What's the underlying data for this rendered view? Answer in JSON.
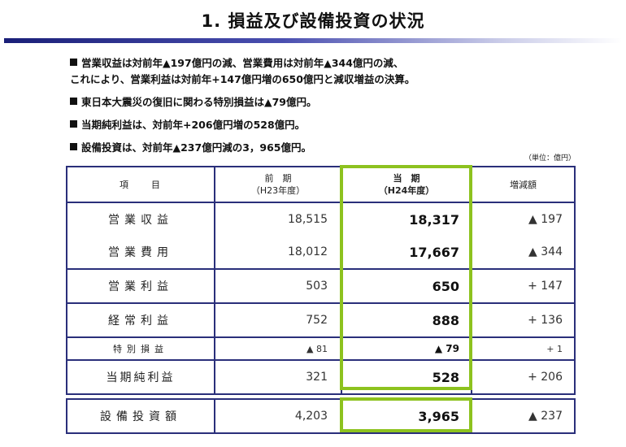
{
  "title": "1. 損益及び設備投資の状況",
  "bullets": [
    "営業収益は対前年▲197億円の減、営業費用は対前年▲344億円の減、",
    "これにより、営業利益は対前年+147億円増の650億円と減収増益の決算。",
    "東日本大震災の復旧に関わる特別損益は▲79億円。",
    "当期純利益は、対前年+206億円増の528億円。",
    "設備投資は、対前年▲237億円減の3，965億円。"
  ],
  "unit_note": "（単位：億円）",
  "table": {
    "headers": {
      "item": "項　　目",
      "prev_l1": "前　期",
      "prev_l2": "（H23年度）",
      "cur_l1": "当　期",
      "cur_l2": "（H24年度）",
      "diff": "増減額"
    },
    "rows": [
      {
        "item": "営業収益",
        "prev": "18,515",
        "cur": "18,317",
        "diff": "▲ 197"
      },
      {
        "item": "営業費用",
        "prev": "18,012",
        "cur": "17,667",
        "diff": "▲ 344"
      },
      {
        "item": "営業利益",
        "prev": "503",
        "cur": "650",
        "diff": "+ 147"
      },
      {
        "item": "経常利益",
        "prev": "752",
        "cur": "888",
        "diff": "+ 136"
      },
      {
        "item": "特別損益",
        "prev": "▲ 81",
        "cur": "▲ 79",
        "diff": "+ 1"
      },
      {
        "item": "当期純利益",
        "prev": "321",
        "cur": "528",
        "diff": "+ 206"
      }
    ],
    "capex": {
      "item": "設備投資額",
      "prev": "4,203",
      "cur": "3,965",
      "diff": "▲ 237"
    }
  },
  "colors": {
    "accent_border": "#8dc21f",
    "table_border": "#2a2f7a",
    "title_bar": "#1a1f78"
  }
}
